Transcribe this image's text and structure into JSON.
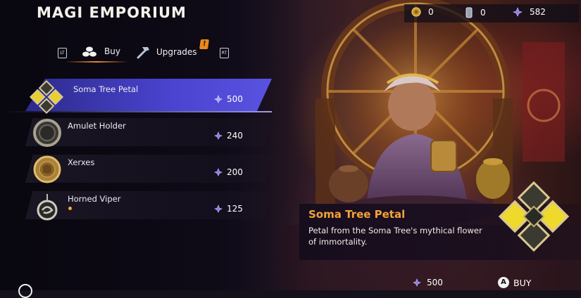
{
  "header": {
    "title": "MAGI EMPORIUM"
  },
  "currency": [
    {
      "icon": "gold-coin-icon",
      "value": "0"
    },
    {
      "icon": "silver-tablet-icon",
      "value": "0"
    },
    {
      "icon": "time-crystal-icon",
      "value": "582"
    }
  ],
  "tabs": {
    "left_trigger": "LT",
    "right_trigger": "RT",
    "buy_label": "Buy",
    "upgrades_label": "Upgrades",
    "upgrades_badge": "!"
  },
  "items": [
    {
      "name": "Soma Tree Petal",
      "price": "500",
      "icon": "soma-tree-petal-icon",
      "selected": true
    },
    {
      "name": "Amulet Holder",
      "price": "240",
      "icon": "amulet-holder-icon"
    },
    {
      "name": "Xerxes",
      "price": "200",
      "icon": "xerxes-coin-icon"
    },
    {
      "name": "Horned Viper",
      "price": "125",
      "icon": "horned-viper-icon",
      "new": true
    }
  ],
  "detail": {
    "title": "Soma Tree Petal",
    "description": "Petal from the Soma Tree's mythical flower of immortality.",
    "price": "500",
    "button_glyph": "A",
    "buy_label": "BUY"
  },
  "colors": {
    "accent_orange": "#f2a33a",
    "selection_blue": "#4a44d0",
    "crystal_purple": "#8a7cf0"
  }
}
